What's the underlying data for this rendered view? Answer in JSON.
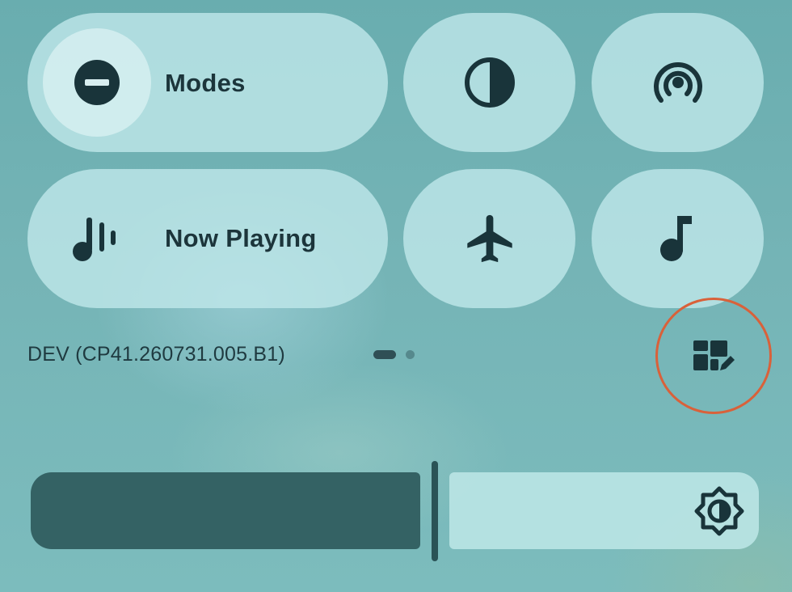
{
  "quick_settings": {
    "tiles": [
      {
        "id": "modes",
        "label": "Modes",
        "icon": "do-not-disturb-icon"
      },
      {
        "id": "color-inversion",
        "label": "",
        "icon": "color-inversion-icon"
      },
      {
        "id": "hotspot",
        "label": "",
        "icon": "hotspot-icon"
      },
      {
        "id": "now-playing",
        "label": "Now Playing",
        "icon": "now-playing-icon"
      },
      {
        "id": "airplane-mode",
        "label": "",
        "icon": "airplane-icon"
      },
      {
        "id": "music",
        "label": "",
        "icon": "music-note-icon"
      }
    ],
    "build_number": "DEV (CP41.260731.005.B1)",
    "page_indicator": {
      "current_page": 1,
      "total_pages": 2
    },
    "edit_icon": "edit-tiles-icon",
    "edit_highlight_color": "#d9613a"
  },
  "brightness": {
    "icon": "brightness-auto-icon",
    "level": 0.55,
    "fill_color": "#346264"
  }
}
